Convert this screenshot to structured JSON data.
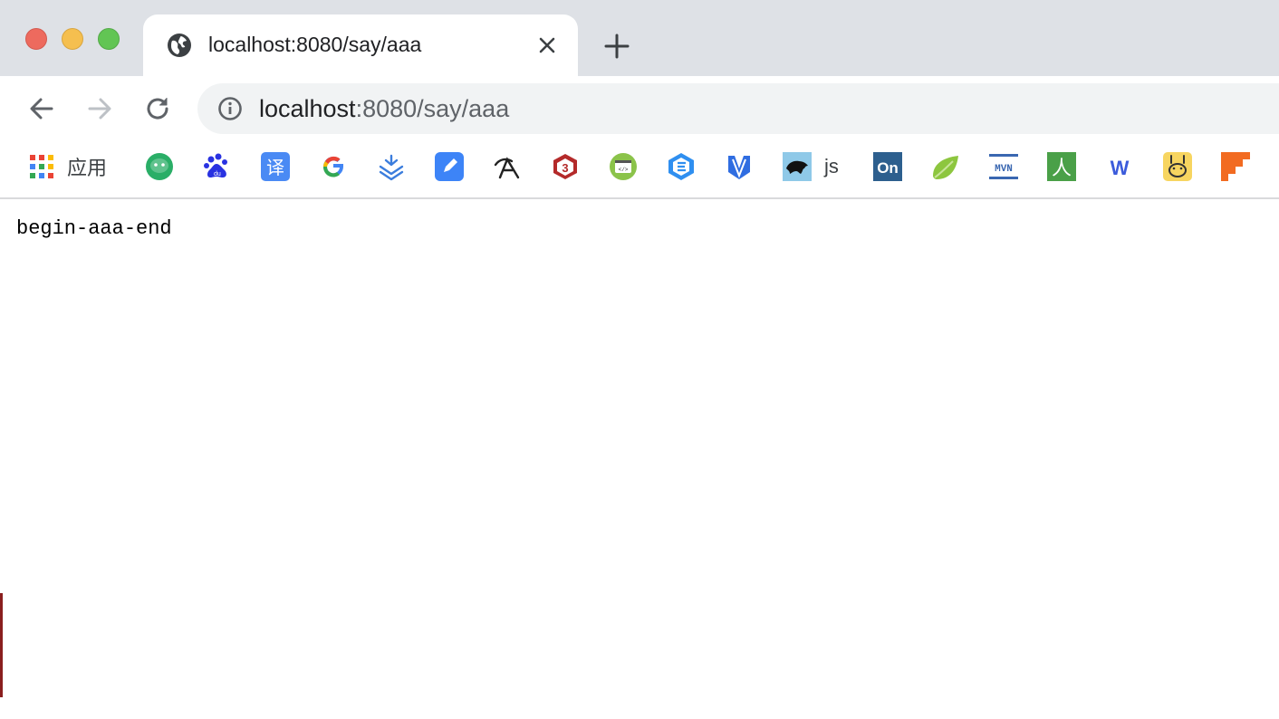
{
  "tab": {
    "title": "localhost:8080/say/aaa",
    "favicon": "globe-icon"
  },
  "address_bar": {
    "host": "localhost",
    "rest": ":8080/say/aaa",
    "icon": "info-icon"
  },
  "bookmarks": [
    {
      "icon": "apps-grid-icon",
      "label": "应用"
    },
    {
      "icon": "wechat-icon"
    },
    {
      "icon": "baidu-icon"
    },
    {
      "icon": "translate-icon"
    },
    {
      "icon": "google-icon"
    },
    {
      "icon": "download-chevrons-icon"
    },
    {
      "icon": "edit-note-icon"
    },
    {
      "icon": "sketch-figure-icon"
    },
    {
      "icon": "three-js-icon"
    },
    {
      "icon": "code-window-icon"
    },
    {
      "icon": "e-hexagon-icon"
    },
    {
      "icon": "v-shield-icon"
    },
    {
      "icon": "black-panther-icon",
      "label": "js"
    },
    {
      "icon": "on-tile-icon",
      "text": "On"
    },
    {
      "icon": "leaf-icon"
    },
    {
      "icon": "mvn-icon",
      "text": "MVN"
    },
    {
      "icon": "person-char-icon",
      "text": "人"
    },
    {
      "icon": "w-letter-icon",
      "text": "W"
    },
    {
      "icon": "bunny-face-icon"
    },
    {
      "icon": "orange-stairs-icon"
    }
  ],
  "page": {
    "text": "begin-aaa-end"
  },
  "colors": {
    "tabstrip": "#dee1e6",
    "omnibox": "#f1f3f4",
    "close": "#ed6a5e",
    "minimize": "#f5bf4f",
    "maximize": "#62c554"
  }
}
